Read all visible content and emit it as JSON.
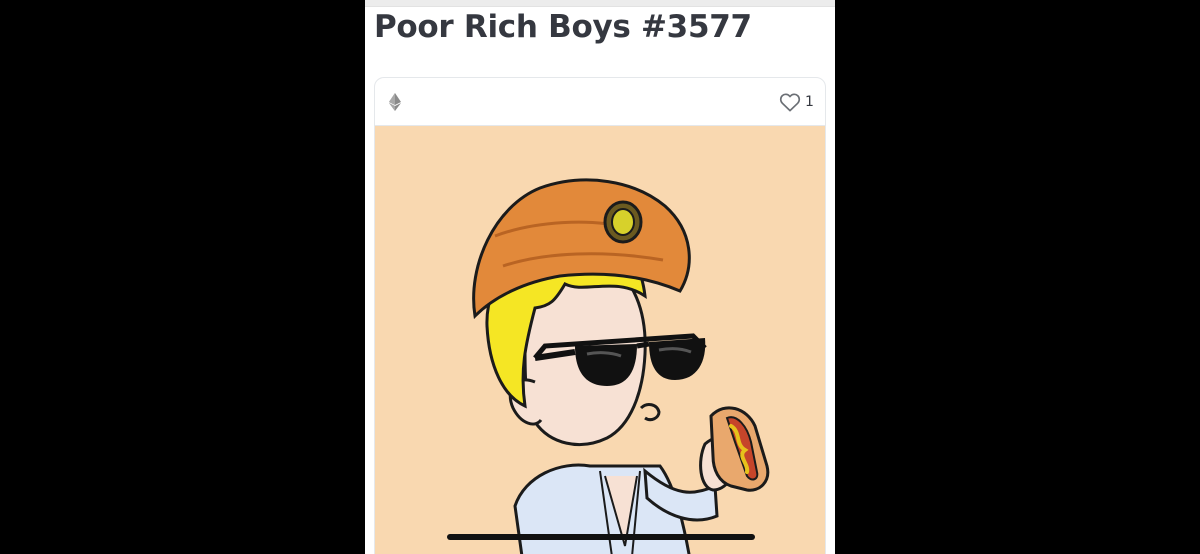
{
  "page": {
    "title": "Poor Rich Boys #3577",
    "background_color": "#000000"
  },
  "item_card": {
    "chain_icon": "ethereum-icon",
    "favorite_icon": "heart-outline-icon",
    "favorite_count": "1",
    "artwork_background": "#f9d8b0"
  },
  "colors": {
    "title_text": "#353840",
    "card_border": "#e5e8eb"
  }
}
